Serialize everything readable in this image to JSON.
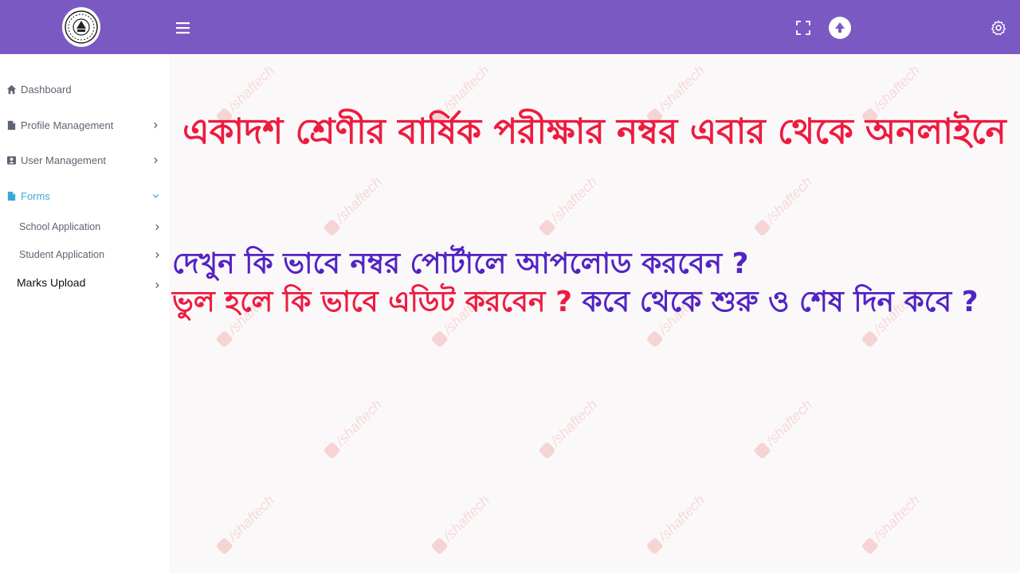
{
  "topbar": {
    "logo": "school-emblem",
    "menu_icon": "hamburger-icon",
    "fullscreen_icon": "fullscreen-icon",
    "avatar_icon": "user-avatar",
    "settings_icon": "gear-icon",
    "color": "#7b59c3"
  },
  "sidebar": {
    "items": [
      {
        "label": "Dashboard",
        "icon": "home-icon",
        "has_chevron": false,
        "active": false
      },
      {
        "label": "Profile Management",
        "icon": "document-icon",
        "has_chevron": true,
        "active": false
      },
      {
        "label": "User Management",
        "icon": "user-card-icon",
        "has_chevron": true,
        "active": false
      },
      {
        "label": "Forms",
        "icon": "document-icon",
        "has_chevron": true,
        "active": true
      }
    ],
    "sub_items": [
      {
        "label": "School Application"
      },
      {
        "label": "Student Application"
      },
      {
        "label": "Marks Upload"
      }
    ],
    "active_color": "#3aa8d8"
  },
  "overlay": {
    "headline": "একাদশ শ্রেণীর বার্ষিক পরীক্ষার নম্বর এবার থেকে অনলাইনে",
    "question_1": "দেখুন  কি ভাবে নম্বর পোর্টালে আপলোড করবেন ?",
    "question_2_red": "ভুল হলে কি ভাবে এডিট করবেন ?",
    "question_2_blue": " কবে থেকে শুরু ও শেষ দিন কবে ?",
    "headline_color": "#ee1b3f",
    "question_color": "#5223c4"
  },
  "watermark": {
    "text": "/shaftech"
  }
}
